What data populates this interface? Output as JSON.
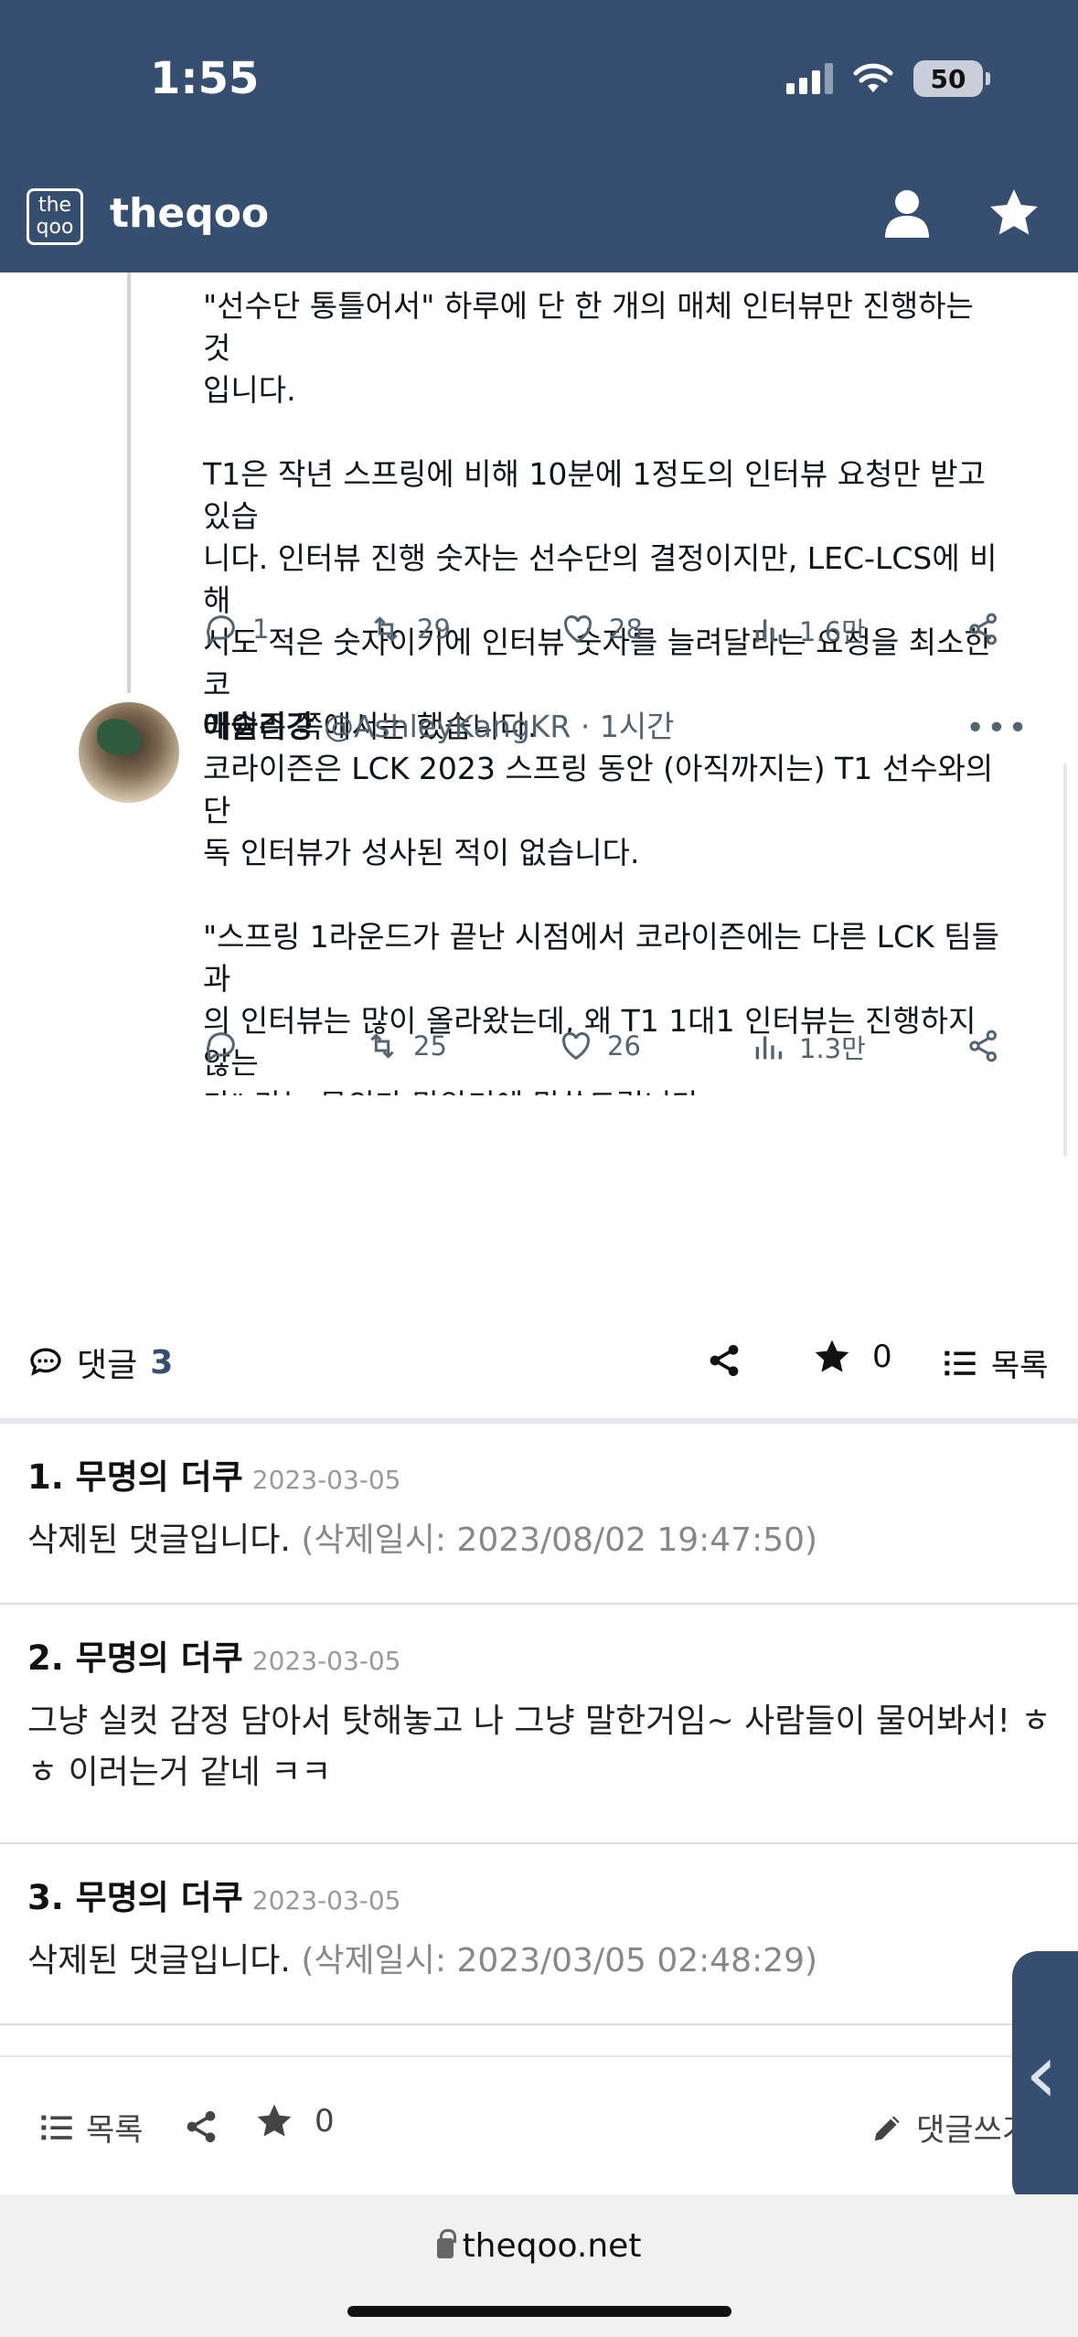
{
  "status_bar": {
    "time": "1:55",
    "battery": "50"
  },
  "header": {
    "logo_text": "the\nqoo",
    "site_title": "theqoo"
  },
  "tweets": [
    {
      "text_lines": [
        "\"선수단 통틀어서\" 하루에 단 한 개의 매체 인터뷰만 진행하는 것",
        "입니다.",
        "",
        "T1은 작년 스프링에 비해 10분에 1정도의 인터뷰 요청만 받고 있습",
        "니다. 인터뷰 진행 숫자는 선수단의 결정이지만, LEC-LCS에 비해",
        "서도 적은 숫자이기에 인터뷰 숫자를 늘려달라는 요청을 최소한 코",
        "라이즌 쪽에서는 했습니다."
      ],
      "replies": "1",
      "retweets": "29",
      "likes": "28",
      "views": "1.6만"
    },
    {
      "author_name": "애슐리강",
      "handle_time": "@AshleyKangKR · 1시간",
      "text_lines": [
        "코라이즌은 LCK 2023 스프링 동안 (아직까지는) T1 선수와의 단",
        "독 인터뷰가 성사된 적이 없습니다.",
        "",
        "\"스프링 1라운드가 끝난 시점에서 코라이즌에는 다른 LCK 팀들과",
        "의 인터뷰는 많이 올라왔는데, 왜 T1 1대1 인터뷰는 진행하지 않는",
        "가\" 라는 문의가 많았기에 말씀드립니다."
      ],
      "replies": "",
      "retweets": "25",
      "likes": "26",
      "views": "1.3만"
    }
  ],
  "comments_bar": {
    "label": "댓글",
    "count": "3",
    "star_count": "0",
    "list_label": "목록"
  },
  "comments": [
    {
      "author": "1. 무명의 더쿠",
      "date": "2023-03-05",
      "body": "삭제된 댓글입니다.",
      "meta": "(삭제일시: 2023/08/02 19:47:50)"
    },
    {
      "author": "2. 무명의 더쿠",
      "date": "2023-03-05",
      "body": "그냥 실컷 감정 담아서 탓해놓고 나 그냥 말한거임~ 사람들이 물어봐서! ㅎㅎ 이러는거 같네 ㅋㅋ",
      "meta": ""
    },
    {
      "author": "3. 무명의 더쿠",
      "date": "2023-03-05",
      "body": "삭제된 댓글입니다.",
      "meta": "(삭제일시: 2023/03/05 02:48:29)"
    }
  ],
  "bottom_bar": {
    "list_label": "목록",
    "star_count": "0",
    "write_label": "댓글쓰기"
  },
  "url_bar": {
    "domain": "theqoo.net"
  },
  "colors": {
    "header_bg": "#364f71",
    "accent": "#364f71",
    "muted": "#536471"
  }
}
